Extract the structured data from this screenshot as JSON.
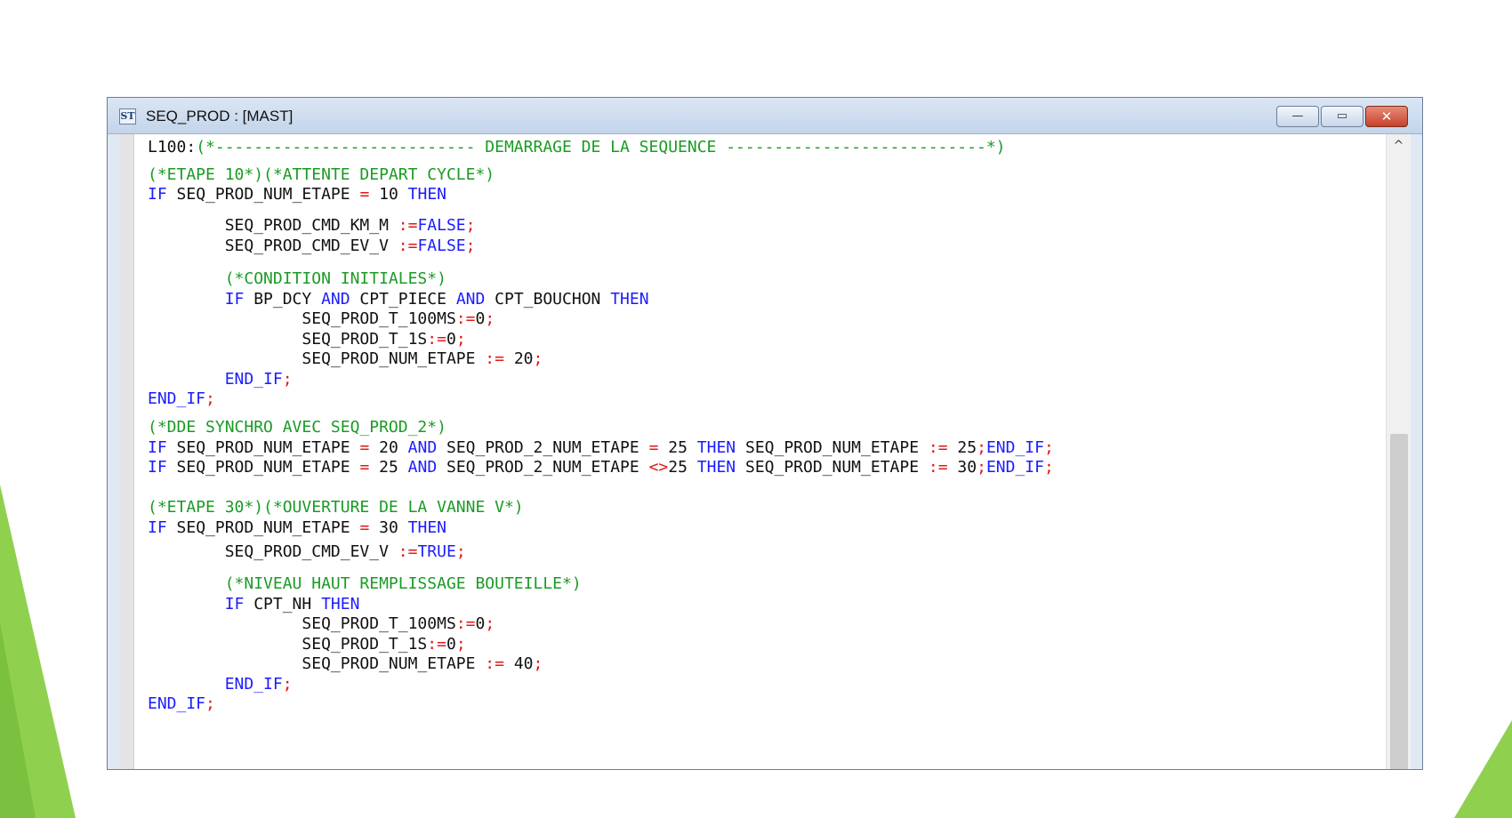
{
  "window": {
    "title": "SEQ_PROD : [MAST]",
    "icon": "program-icon",
    "icon_glyph": "ST",
    "minimize_glyph": "—",
    "maximize_glyph": "▭",
    "close_glyph": "✕"
  },
  "colors": {
    "keyword": "#1c1cff",
    "operator": "#e01818",
    "comment": "#1a9b24",
    "text": "#111111",
    "slide_accent": "#8fd14f"
  },
  "scrollbar": {
    "up_glyph": "^",
    "position": 0.47
  },
  "code": {
    "lines": [
      [
        [
          "tx",
          "L100:"
        ],
        [
          "cm",
          "(*--------------------------- DEMARRAGE DE LA SEQUENCE ---------------------------*)"
        ]
      ],
      [
        [
          "cm",
          "(*ETAPE 10*)(*ATTENTE DEPART CYCLE*)"
        ]
      ],
      [
        [
          "kw",
          "IF"
        ],
        [
          "tx",
          " SEQ_PROD_NUM_ETAPE "
        ],
        [
          "op",
          "="
        ],
        [
          "tx",
          " 10 "
        ],
        [
          "kw",
          "THEN"
        ]
      ],
      [
        [
          "tx",
          "        SEQ_PROD_CMD_KM_M "
        ],
        [
          "op",
          ":="
        ],
        [
          "kw",
          "FALSE"
        ],
        [
          "op",
          ";"
        ]
      ],
      [
        [
          "tx",
          "        SEQ_PROD_CMD_EV_V "
        ],
        [
          "op",
          ":="
        ],
        [
          "kw",
          "FALSE"
        ],
        [
          "op",
          ";"
        ]
      ],
      [
        [
          "cm",
          "        (*CONDITION INITIALES*)"
        ]
      ],
      [
        [
          "kw",
          "        IF"
        ],
        [
          "tx",
          " BP_DCY "
        ],
        [
          "kw",
          "AND"
        ],
        [
          "tx",
          " CPT_PIECE "
        ],
        [
          "kw",
          "AND"
        ],
        [
          "tx",
          " CPT_BOUCHON "
        ],
        [
          "kw",
          "THEN"
        ]
      ],
      [
        [
          "tx",
          "                SEQ_PROD_T_100MS"
        ],
        [
          "op",
          ":="
        ],
        [
          "tx",
          "0"
        ],
        [
          "op",
          ";"
        ]
      ],
      [
        [
          "tx",
          "                SEQ_PROD_T_1S"
        ],
        [
          "op",
          ":="
        ],
        [
          "tx",
          "0"
        ],
        [
          "op",
          ";"
        ]
      ],
      [
        [
          "tx",
          "                SEQ_PROD_NUM_ETAPE "
        ],
        [
          "op",
          ":="
        ],
        [
          "tx",
          " 20"
        ],
        [
          "op",
          ";"
        ]
      ],
      [
        [
          "kw",
          "        END_IF"
        ],
        [
          "op",
          ";"
        ]
      ],
      [
        [
          "kw",
          "END_IF"
        ],
        [
          "op",
          ";"
        ]
      ],
      [
        [
          "cm",
          "(*DDE SYNCHRO AVEC SEQ_PROD_2*)"
        ]
      ],
      [
        [
          "kw",
          "IF"
        ],
        [
          "tx",
          " SEQ_PROD_NUM_ETAPE "
        ],
        [
          "op",
          "="
        ],
        [
          "tx",
          " 20 "
        ],
        [
          "kw",
          "AND"
        ],
        [
          "tx",
          " SEQ_PROD_2_NUM_ETAPE "
        ],
        [
          "op",
          "="
        ],
        [
          "tx",
          " 25 "
        ],
        [
          "kw",
          "THEN"
        ],
        [
          "tx",
          " SEQ_PROD_NUM_ETAPE "
        ],
        [
          "op",
          ":="
        ],
        [
          "tx",
          " 25"
        ],
        [
          "op",
          ";"
        ],
        [
          "kw",
          "END_IF"
        ],
        [
          "op",
          ";"
        ]
      ],
      [
        [
          "kw",
          "IF"
        ],
        [
          "tx",
          " SEQ_PROD_NUM_ETAPE "
        ],
        [
          "op",
          "="
        ],
        [
          "tx",
          " 25 "
        ],
        [
          "kw",
          "AND"
        ],
        [
          "tx",
          " SEQ_PROD_2_NUM_ETAPE "
        ],
        [
          "op",
          "<>"
        ],
        [
          "tx",
          "25 "
        ],
        [
          "kw",
          "THEN"
        ],
        [
          "tx",
          " SEQ_PROD_NUM_ETAPE "
        ],
        [
          "op",
          ":="
        ],
        [
          "tx",
          " 30"
        ],
        [
          "op",
          ";"
        ],
        [
          "kw",
          "END_IF"
        ],
        [
          "op",
          ";"
        ]
      ],
      [
        [
          "cm",
          "(*ETAPE 30*)(*OUVERTURE DE LA VANNE V*)"
        ]
      ],
      [
        [
          "kw",
          "IF"
        ],
        [
          "tx",
          " SEQ_PROD_NUM_ETAPE "
        ],
        [
          "op",
          "="
        ],
        [
          "tx",
          " 30 "
        ],
        [
          "kw",
          "THEN"
        ]
      ],
      [
        [
          "tx",
          "        SEQ_PROD_CMD_EV_V "
        ],
        [
          "op",
          ":="
        ],
        [
          "kw",
          "TRUE"
        ],
        [
          "op",
          ";"
        ]
      ],
      [
        [
          "cm",
          "        (*NIVEAU HAUT REMPLISSAGE BOUTEILLE*)"
        ]
      ],
      [
        [
          "kw",
          "        IF"
        ],
        [
          "tx",
          " CPT_NH "
        ],
        [
          "kw",
          "THEN"
        ]
      ],
      [
        [
          "tx",
          "                SEQ_PROD_T_100MS"
        ],
        [
          "op",
          ":="
        ],
        [
          "tx",
          "0"
        ],
        [
          "op",
          ";"
        ]
      ],
      [
        [
          "tx",
          "                SEQ_PROD_T_1S"
        ],
        [
          "op",
          ":="
        ],
        [
          "tx",
          "0"
        ],
        [
          "op",
          ";"
        ]
      ],
      [
        [
          "tx",
          "                SEQ_PROD_NUM_ETAPE "
        ],
        [
          "op",
          ":="
        ],
        [
          "tx",
          " 40"
        ],
        [
          "op",
          ";"
        ]
      ],
      [
        [
          "kw",
          "        END_IF"
        ],
        [
          "op",
          ";"
        ]
      ],
      [
        [
          "kw",
          "END_IF"
        ],
        [
          "op",
          ";"
        ]
      ]
    ]
  }
}
